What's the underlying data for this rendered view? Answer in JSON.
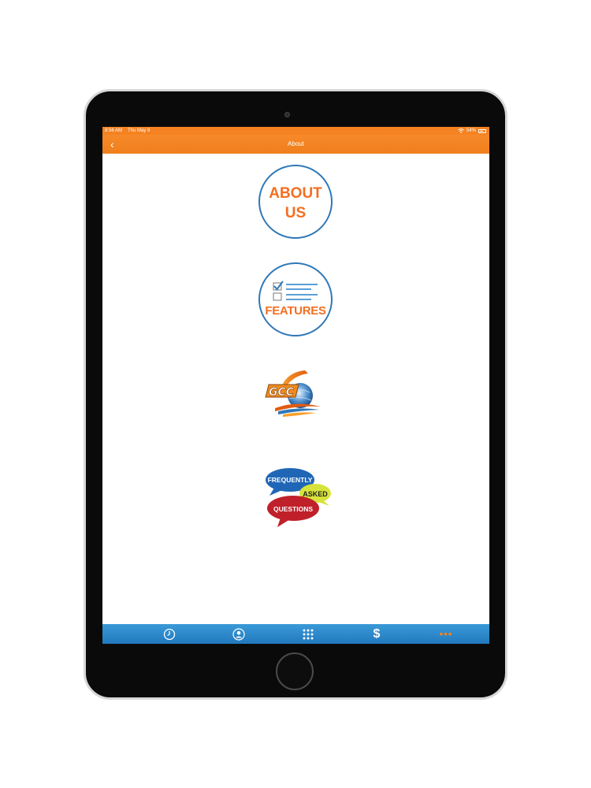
{
  "status_bar": {
    "time": "8:56 AM",
    "date": "Thu May 9",
    "battery": "54%",
    "battery_level": 0.54
  },
  "nav": {
    "back_glyph": "‹",
    "title": "About"
  },
  "menu": {
    "about_us": {
      "line1": "ABOUT",
      "line2": "US"
    },
    "features": {
      "label": "FEATURES",
      "icon": "checklist-icon"
    },
    "company_logo": {
      "icon": "globe-logo-icon",
      "logo_text": "GCC"
    },
    "faq": {
      "word1": "FREQUENTLY",
      "word2": "ASKED",
      "word3": "QUESTIONS"
    }
  },
  "tab_bar": {
    "tabs": [
      {
        "icon": "clock-icon"
      },
      {
        "icon": "contact-icon"
      },
      {
        "icon": "keypad-icon"
      },
      {
        "icon": "dollar-icon",
        "glyph": "$"
      },
      {
        "icon": "more-icon",
        "glyph": "•••"
      }
    ]
  },
  "colors": {
    "orange": "#f58220",
    "blue": "#2f77b8",
    "tab_blue": "#2a86c8",
    "text_orange": "#f26f21"
  }
}
